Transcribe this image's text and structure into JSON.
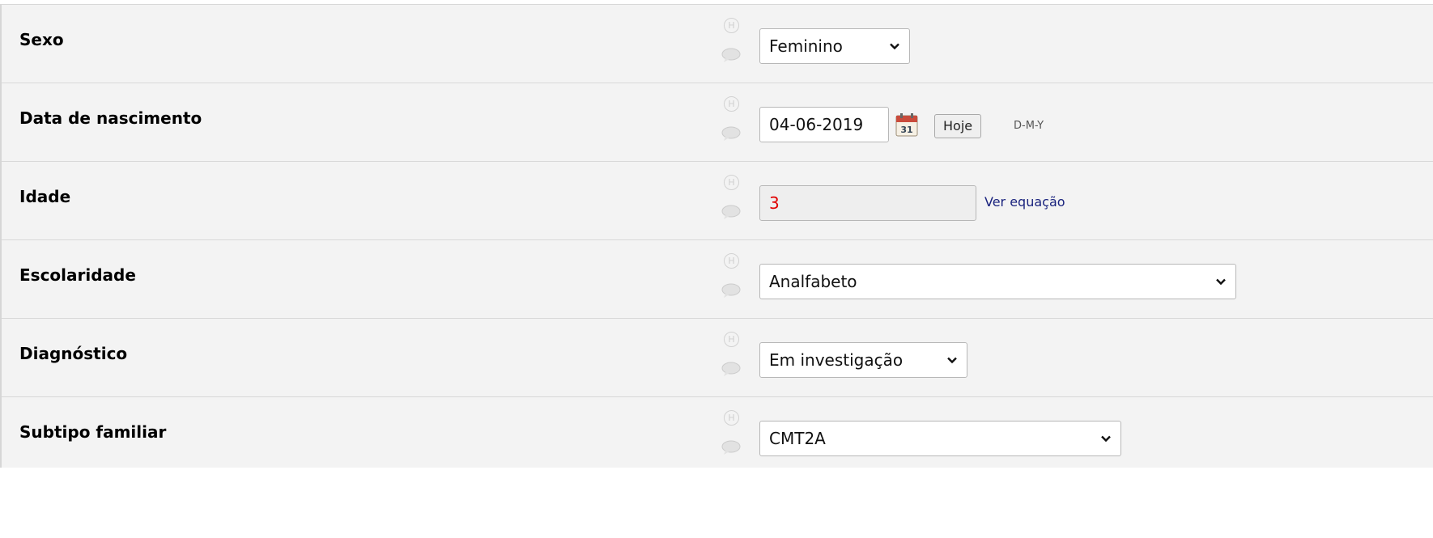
{
  "fields": {
    "sexo": {
      "label": "Sexo",
      "value": "Feminino"
    },
    "data_nascimento": {
      "label": "Data de nascimento",
      "value": "04-06-2019",
      "today_button": "Hoje",
      "format_hint": "D-M-Y"
    },
    "idade": {
      "label": "Idade",
      "value": "3",
      "equation_link": "Ver equação"
    },
    "escolaridade": {
      "label": "Escolaridade",
      "value": "Analfabeto"
    },
    "diagnostico": {
      "label": "Diagnóstico",
      "value": "Em investigação"
    },
    "subtipo_familiar": {
      "label": "Subtipo familiar",
      "value": "CMT2A"
    }
  },
  "icons": {
    "history": "history-H-icon",
    "comment": "comment-bubble-icon",
    "calendar": "calendar-icon",
    "dropdown": "chevron-down-icon"
  },
  "colors": {
    "row_background": "#f3f3f3",
    "calculated_value": "#e00000",
    "link": "#1a237e"
  },
  "glyphs": {
    "history": "H",
    "calendar_day": "31"
  }
}
